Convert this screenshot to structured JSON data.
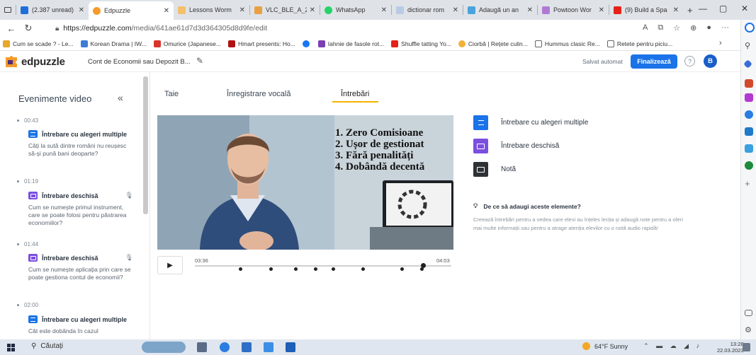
{
  "browser": {
    "tabs": [
      {
        "title": "(2.387 unread)",
        "favicon_color": "#1e6fd9"
      },
      {
        "title": "Edpuzzle",
        "favicon_color": "#f59b2a"
      },
      {
        "title": "Lessons Worm",
        "favicon_color": "#f3c06b"
      },
      {
        "title": "VLC_BLE_A_20",
        "favicon_color": "#e8a040"
      },
      {
        "title": "WhatsApp",
        "favicon_color": "#25d366"
      },
      {
        "title": "dictionar rom",
        "favicon_color": "#b9cbe3"
      },
      {
        "title": "Adaugă un an",
        "favicon_color": "#4aa3df"
      },
      {
        "title": "Powtoon Wor",
        "favicon_color": "#b07ad4"
      },
      {
        "title": "(9) Build a Spa",
        "favicon_color": "#e62117"
      }
    ],
    "new_tab": "+",
    "window_controls": [
      "—",
      "▢",
      "✕"
    ],
    "url": {
      "host": "https://edpuzzle.com",
      "path": "/media/641ae61d7d3d364305d8d9fe/edit"
    },
    "bookmarks": [
      {
        "label": "Cum se scade ? - Le...",
        "color": "#e8a72a"
      },
      {
        "label": "Korean Drama | IW...",
        "color": "#3b7dd8"
      },
      {
        "label": "Omurice (Japanese...",
        "color": "#d9342b"
      },
      {
        "label": "Hmart presents: Ho...",
        "color": "#b01212"
      },
      {
        "label": "",
        "color": "#1877f2"
      },
      {
        "label": "Iahnie de fasole rot...",
        "color": "#7b3fb4"
      },
      {
        "label": "Shuffle tatting  Yo...",
        "color": "#e62117"
      },
      {
        "label": "Ciorbă | Rețete culin...",
        "color": "#f0b23a"
      },
      {
        "label": "Hummus clasic  Re...",
        "color": "#666666"
      },
      {
        "label": "Retete pentru piciu...",
        "color": "#666666"
      }
    ]
  },
  "app": {
    "logo": "edpuzzle",
    "lesson_title": "Cont de Economii sau Depozit B...",
    "autosave": "Salvat automat",
    "finalize_label": "Finalizează",
    "help": "?",
    "avatar_initial": "B",
    "brand_color": "#1a73e8"
  },
  "events_panel": {
    "title": "Evenimente video",
    "collapse": "«",
    "events": [
      {
        "time": "00:43",
        "type": "Întrebare cu alegeri multiple",
        "text": "Câți la sută dintre români nu reușesc să-și pună bani deoparte?",
        "mic": false
      },
      {
        "time": "01:19",
        "type": "Întrebare deschisă",
        "text": "Cum se numește primul instrument, care se poate folosi pentru păstrarea economiilor?",
        "mic": true
      },
      {
        "time": "01:44",
        "type": "Întrebare deschisă",
        "text": "Cum se numește aplicația prin care se poate gestiona contul de economii?",
        "mic": true
      },
      {
        "time": "02:00",
        "type": "Întrebare cu alegeri multiple",
        "text": "Cât este dobânda în cazul",
        "mic": false
      }
    ]
  },
  "main_tabs": [
    {
      "label": "Taie"
    },
    {
      "label": "Înregistrare vocală"
    },
    {
      "label": "Întrebări"
    }
  ],
  "video": {
    "overlay_lines": [
      "1. Zero Comisioane",
      "2. Ușor de gestionat",
      "3. Fără penalități",
      "4. Dobândă decentă"
    ],
    "current_time": "03:36",
    "duration": "04:03",
    "progress": 0.889,
    "play_icon": "play-icon",
    "markers": [
      0.177,
      0.296,
      0.391,
      0.469,
      0.538,
      0.654,
      0.807,
      0.885
    ]
  },
  "question_options": [
    {
      "label": "Întrebare cu alegeri multiple",
      "icon": "list-icon",
      "color": "#1a73e8"
    },
    {
      "label": "Întrebare deschisă",
      "icon": "chat-icon",
      "color": "#7b4fe0"
    },
    {
      "label": "Notă",
      "icon": "note-icon",
      "color": "#2e3135"
    }
  ],
  "why_section": {
    "title": "De ce să adaugi aceste elemente?",
    "text": "Creează întrebări pentru a vedea care elevi au înțeles lecția și adaugă note pentru a oferi mai multe informații sau pentru a atrage atenția elevilor cu o notă audio rapidă!"
  },
  "taskbar": {
    "search": "Căutați",
    "weather": "64°F  Sunny",
    "time": "13:28",
    "date": "22.03.2023"
  }
}
